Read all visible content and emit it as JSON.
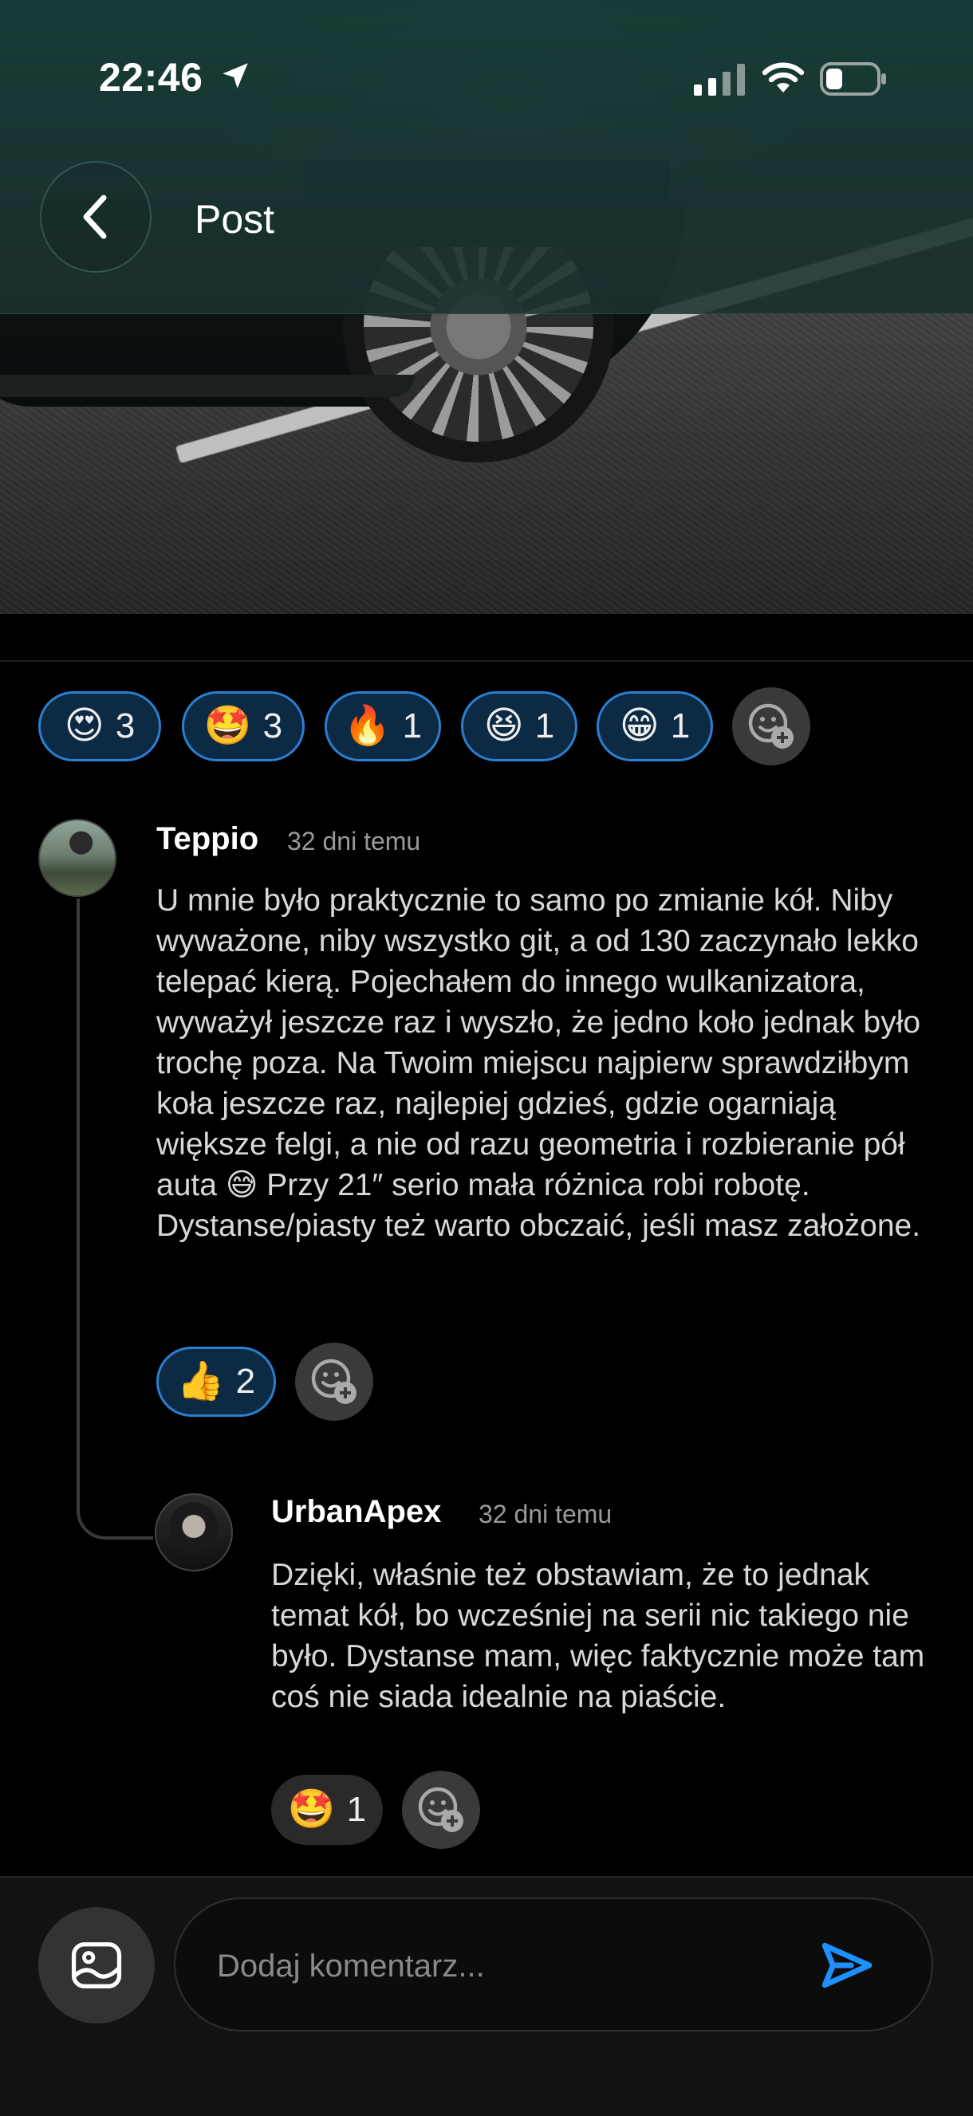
{
  "status_bar": {
    "time": "22:46"
  },
  "header": {
    "title": "Post"
  },
  "post_reactions": [
    {
      "emoji": "😍",
      "count": "3"
    },
    {
      "emoji": "🤩",
      "count": "3"
    },
    {
      "emoji": "🔥",
      "count": "1"
    },
    {
      "emoji": "😆",
      "count": "1"
    },
    {
      "emoji": "😁",
      "count": "1"
    }
  ],
  "comments": [
    {
      "author": "Teppio",
      "time": "32 dni temu",
      "text": "U mnie było praktycznie to samo po zmianie kół. Niby wyważone, niby wszystko git, a od 130 zaczynało lekko telepać kierą. Pojechałem do innego wulkanizatora, wyważył jeszcze raz i wyszło, że jedno koło jednak było trochę poza. Na Twoim miejscu najpierw sprawdziłbym koła jeszcze raz, najlepiej gdzieś, gdzie ogarniają większe felgi, a nie od razu geometria i rozbieranie pół auta 😅 Przy 21″ serio mała różnica robi robotę. Dystanse/piasty też warto obczaić, jeśli masz założone.",
      "reactions": [
        {
          "emoji": "👍",
          "count": "2"
        }
      ]
    },
    {
      "author": "UrbanApex",
      "time": "32 dni temu",
      "text": "Dzięki, właśnie też obstawiam, że to jednak temat kół, bo wcześniej na serii nic takiego nie było. Dystanse mam, więc faktycznie może tam coś nie siada idealnie na piaście.",
      "reactions": [
        {
          "emoji": "🤩",
          "count": "1"
        }
      ]
    }
  ],
  "composer": {
    "placeholder": "Dodaj komentarz..."
  },
  "colors": {
    "accent": "#2a7fd0",
    "send": "#1e90ff",
    "header": "#163e38"
  }
}
